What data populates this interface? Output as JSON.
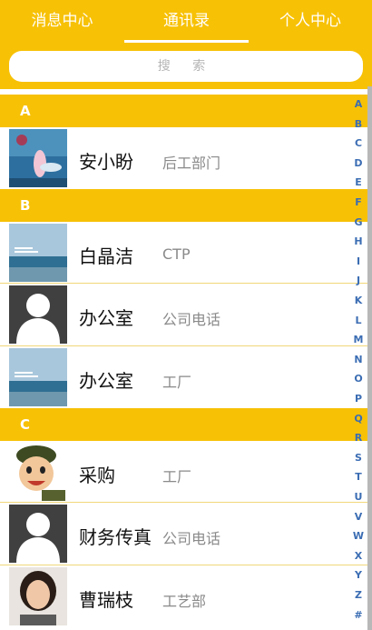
{
  "tabs": [
    "消息中心",
    "通讯录",
    "个人中心"
  ],
  "search": {
    "placeholder": "搜 索"
  },
  "sections": [
    {
      "letter": "A",
      "contacts": [
        {
          "name": "安小盼",
          "dept": "后工部门",
          "avatar": "underwater-photo"
        }
      ]
    },
    {
      "letter": "B",
      "contacts": [
        {
          "name": "白晶洁",
          "dept": "CTP",
          "avatar": "sea-photo"
        },
        {
          "name": "办公室",
          "dept": "公司电话",
          "avatar": "default-person"
        },
        {
          "name": "办公室",
          "dept": "工厂",
          "avatar": "sea-photo"
        }
      ]
    },
    {
      "letter": "C",
      "contacts": [
        {
          "name": "采购",
          "dept": "工厂",
          "avatar": "cartoon-soldier"
        },
        {
          "name": "财务传真",
          "dept": "公司电话",
          "avatar": "default-person"
        },
        {
          "name": "曹瑞枝",
          "dept": "工艺部",
          "avatar": "woman-photo"
        }
      ]
    }
  ],
  "index_letters": [
    "A",
    "B",
    "C",
    "D",
    "E",
    "F",
    "G",
    "H",
    "I",
    "J",
    "K",
    "L",
    "M",
    "N",
    "O",
    "P",
    "Q",
    "R",
    "S",
    "T",
    "U",
    "V",
    "W",
    "X",
    "Y",
    "Z",
    "#"
  ],
  "colors": {
    "accent": "#f7c106",
    "index": "#3b6db3"
  }
}
